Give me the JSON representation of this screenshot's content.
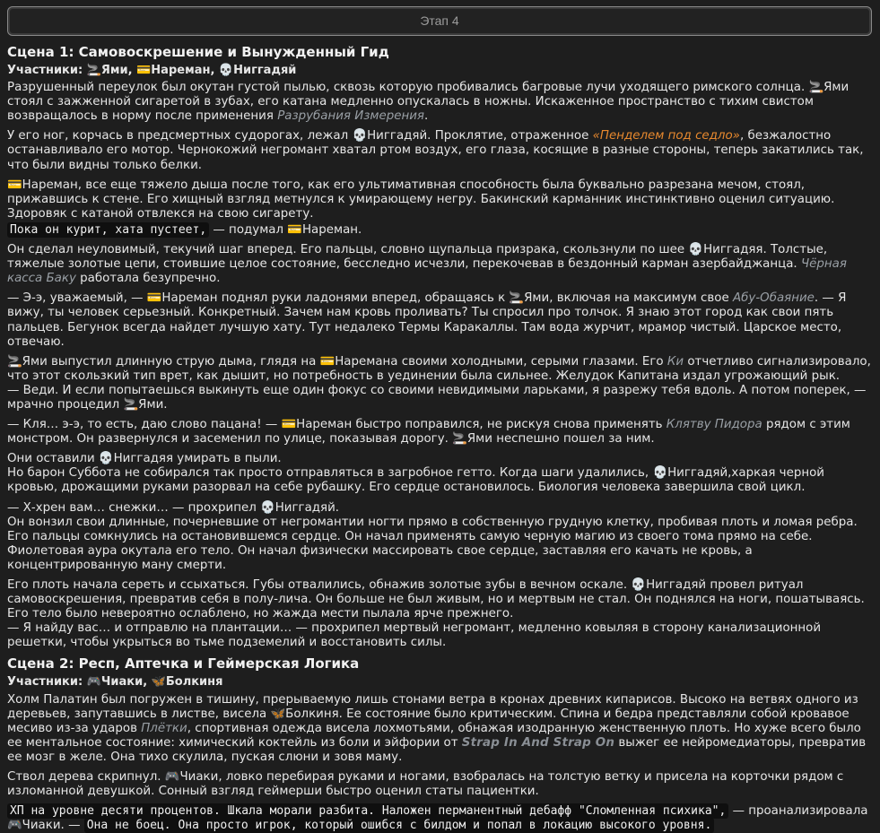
{
  "stage": {
    "label": "Этап 4"
  },
  "scene1": {
    "title": "Сцена 1: Самовоскрешение и Вынужденный Гид",
    "members_label": "Участники:",
    "members": "🚬Ями, 💳Нареман, 💀Ниггадяй",
    "p1a": "Разрушенный переулок был окутан густой пылью, сквозь которую пробивались багровые лучи уходящего римского солнца. 🚬Ями стоял с зажженной сигаретой в зубах, его катана медленно опускалась в ножны. Искаженное пространство с тихим свистом возвращалось в норму после применения ",
    "p1ref": "Разрубания Измерения",
    "p1b": ".",
    "p2a": "У его ног, корчась в предсмертных судорогах, лежал 💀Ниггадяй. Проклятие, отраженное ",
    "p2ref": "«Пенделем под седло»",
    "p2b": ", безжалостно останавливало его мотор. Чернокожий негромант хватал ртом воздух, его глаза, косящие в разные стороны, теперь закатились так, что были видны только белки.",
    "p3": "💳Нареман, все еще тяжело дыша после того, как его ультимативная способность была буквально разрезана мечом, стоял, прижавшись к стене. Его хищный взгляд метнулся к умирающему негру. Бакинский карманник инстинктивно оценил ситуацию. Здоровяк с катаной отвлекся на свою сигарету.",
    "p4code": "Пока он курит, хата пустеет,",
    "p4b": " — подумал 💳Нареман.",
    "p5a": "Он сделал неуловимый, текучий шаг вперед. Его пальцы, словно щупальца призрака, скользнули по шее 💀Ниггадяя. Толстые, тяжелые золотые цепи, стоившие целое состояние, бесследно исчезли, перекочевав в бездонный карман азербайджанца. ",
    "p5ref": "Чёрная касса Баку",
    "p5b": " работала безупречно.",
    "p6a": "— Э-э, уважаемый, — 💳Нареман поднял руки ладонями вперед, обращаясь к 🚬Ями, включая на максимум свое ",
    "p6ref": "Абу-Обаяние",
    "p6b": ". — Я вижу, ты человек серьезный. Конкретный. Зачем нам кровь проливать? Ты спросил про толчок. Я знаю этот город как свои пять пальцев. Бегунок всегда найдет лучшую хату. Тут недалеко Термы Каракаллы. Там вода журчит, мрамор чистый. Царское место, отвечаю.",
    "p7a": "🚬Ями выпустил длинную струю дыма, глядя на 💳Наремана своими холодными, серыми глазами. Его ",
    "p7ref": "Ки",
    "p7b": " отчетливо сигнализировало, что этот скользкий тип врет, как дышит, но потребность в уединении была сильнее. Желудок Капитана издал угрожающий рык.",
    "p7c": "— Веди. И если попытаешься выкинуть еще один фокус со своими невидимыми ларьками, я разрежу тебя вдоль. А потом поперек, — мрачно процедил 🚬Ями.",
    "p8a": "— Кля… э-э, то есть, даю слово пацана! — 💳Нареман быстро поправился, не рискуя снова применять ",
    "p8ref": "Клятву Пидора",
    "p8b": " рядом с этим монстром. Он развернулся и засеменил по улице, показывая дорогу. 🚬Ями неспешно пошел за ним.",
    "p9a": "Они оставили 💀Ниггадяя умирать в пыли.",
    "p9b": "Но барон Суббота не собирался так просто отправляться в загробное гетто. Когда шаги удалились, 💀Ниггадяй,харкая черной кровью, дрожащими руками разорвал на себе рубашку. Его сердце остановилось. Биология человека завершила свой цикл.",
    "p10a": "— Х-хрен вам… снежки… — прохрипел 💀Ниггадяй.",
    "p10b": "Он вонзил свои длинные, почерневшие от негромантии ногти прямо в собственную грудную клетку, пробивая плоть и ломая ребра. Его пальцы сомкнулись на остановившемся сердце. Он начал применять самую черную магию из своего тома прямо на себе. Фиолетовая аура окутала его тело. Он начал физически массировать свое сердце, заставляя его качать не кровь, а концентрированную ману смерти.",
    "p11a": "Его плоть начала сереть и ссыхаться. Губы отвалились, обнажив золотые зубы в вечном оскале. 💀Ниггадяй провел ритуал самовоскрешения, превратив себя в полу-лича. Он больше не был живым, но и мертвым не стал. Он поднялся на ноги, пошатываясь. Его тело было невероятно ослаблено, но жажда мести пылала ярче прежнего.",
    "p11b": "— Я найду вас… и отправлю на плантации… — прохрипел мертвый негромант, медленно ковыляя в сторону канализационной решетки, чтобы укрыться во тьме подземелий и восстановить силы."
  },
  "scene2": {
    "title": "Сцена 2: Респ, Аптечка и Геймерская Логика",
    "members_label": "Участники:",
    "members": "🎮Чиаки, 🦋Болкиня",
    "p1a": "Холм Палатин был погружен в тишину, прерываемую лишь стонами ветра в кронах древних кипарисов. Высоко на ветвях одного из деревьев, запутавшись в листве, висела 🦋Болкиня. Ее состояние было критическим. Спина и бедра представляли собой кровавое месиво из-за ударов ",
    "p1ref": "Плётки",
    "p1b": ", спортивная одежда висела лохмотьями, обнажая изодранную женственную плоть. Но хуже всего было ее ментальное состояние: химический коктейль из боли и эйфории от ",
    "p1cap": "Strap In And Strap On",
    "p1c": " выжег ее нейромедиаторы, превратив ее мозг в желе. Она тихо скулила, пуская слюни и зовя маму.",
    "p2": "Ствол дерева скрипнул. 🎮Чиаки, ловко перебирая руками и ногами, взобралась на толстую ветку и присела на корточки рядом с изломанной девушкой. Сонный взгляд геймерши быстро оценил статы пациентки.",
    "p3code": "ХП на уровне десяти процентов. Шкала морали разбита. Наложен перманентный дебафф \"Сломленная психика\",",
    "p3b": " — проанализировала 🎮Чиаки. — ",
    "p3code2": "Она не боец. Она просто игрок, который ошибся с билдом и попал в локацию высокого уровня."
  }
}
